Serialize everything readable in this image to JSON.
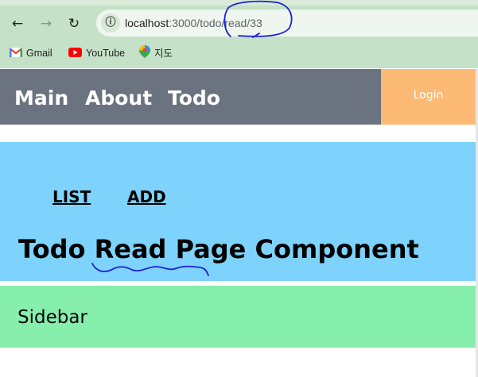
{
  "browser": {
    "back_icon": "←",
    "forward_icon": "→",
    "reload_icon": "↻",
    "site_info_icon": "ⓘ",
    "url_host": "localhost",
    "url_path": ":3000/todo/read/33"
  },
  "bookmarks": [
    {
      "label": "Gmail",
      "icon": "gmail-icon"
    },
    {
      "label": "YouTube",
      "icon": "youtube-icon"
    },
    {
      "label": "지도",
      "icon": "maps-icon"
    }
  ],
  "header": {
    "nav": [
      "Main",
      "About",
      "Todo"
    ],
    "login_label": "Login"
  },
  "content": {
    "links": [
      "LIST",
      "ADD"
    ],
    "title": "Todo Read Page Component"
  },
  "sidebar": {
    "label": "Sidebar"
  },
  "colors": {
    "header_bg": "#6b7280",
    "login_bg": "#fdba74",
    "content_bg": "#7dd3fc",
    "sidebar_bg": "#86efac",
    "chrome_bg": "#c5e1c7",
    "annotation": "#1c20d6"
  }
}
